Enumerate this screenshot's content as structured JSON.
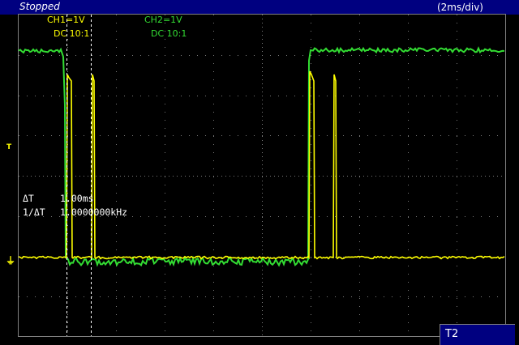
{
  "header": {
    "status": "Stopped",
    "timebase": "(2ms/div)"
  },
  "channels": [
    {
      "name": "CH1=1V",
      "coupling": "DC  10:1",
      "color": "#ffff00"
    },
    {
      "name": "CH2=1V",
      "coupling": "DC  10:1",
      "color": "#33dd33"
    }
  ],
  "measurements": {
    "delta_t_label": "ΔT",
    "delta_t_value": "1.00ms",
    "inv_delta_t_label": "1/ΔT",
    "inv_delta_t_value": "1.0000000kHz"
  },
  "markers": {
    "trigger": "T",
    "ground": "⏚"
  },
  "softkey": {
    "label": "T2"
  }
}
